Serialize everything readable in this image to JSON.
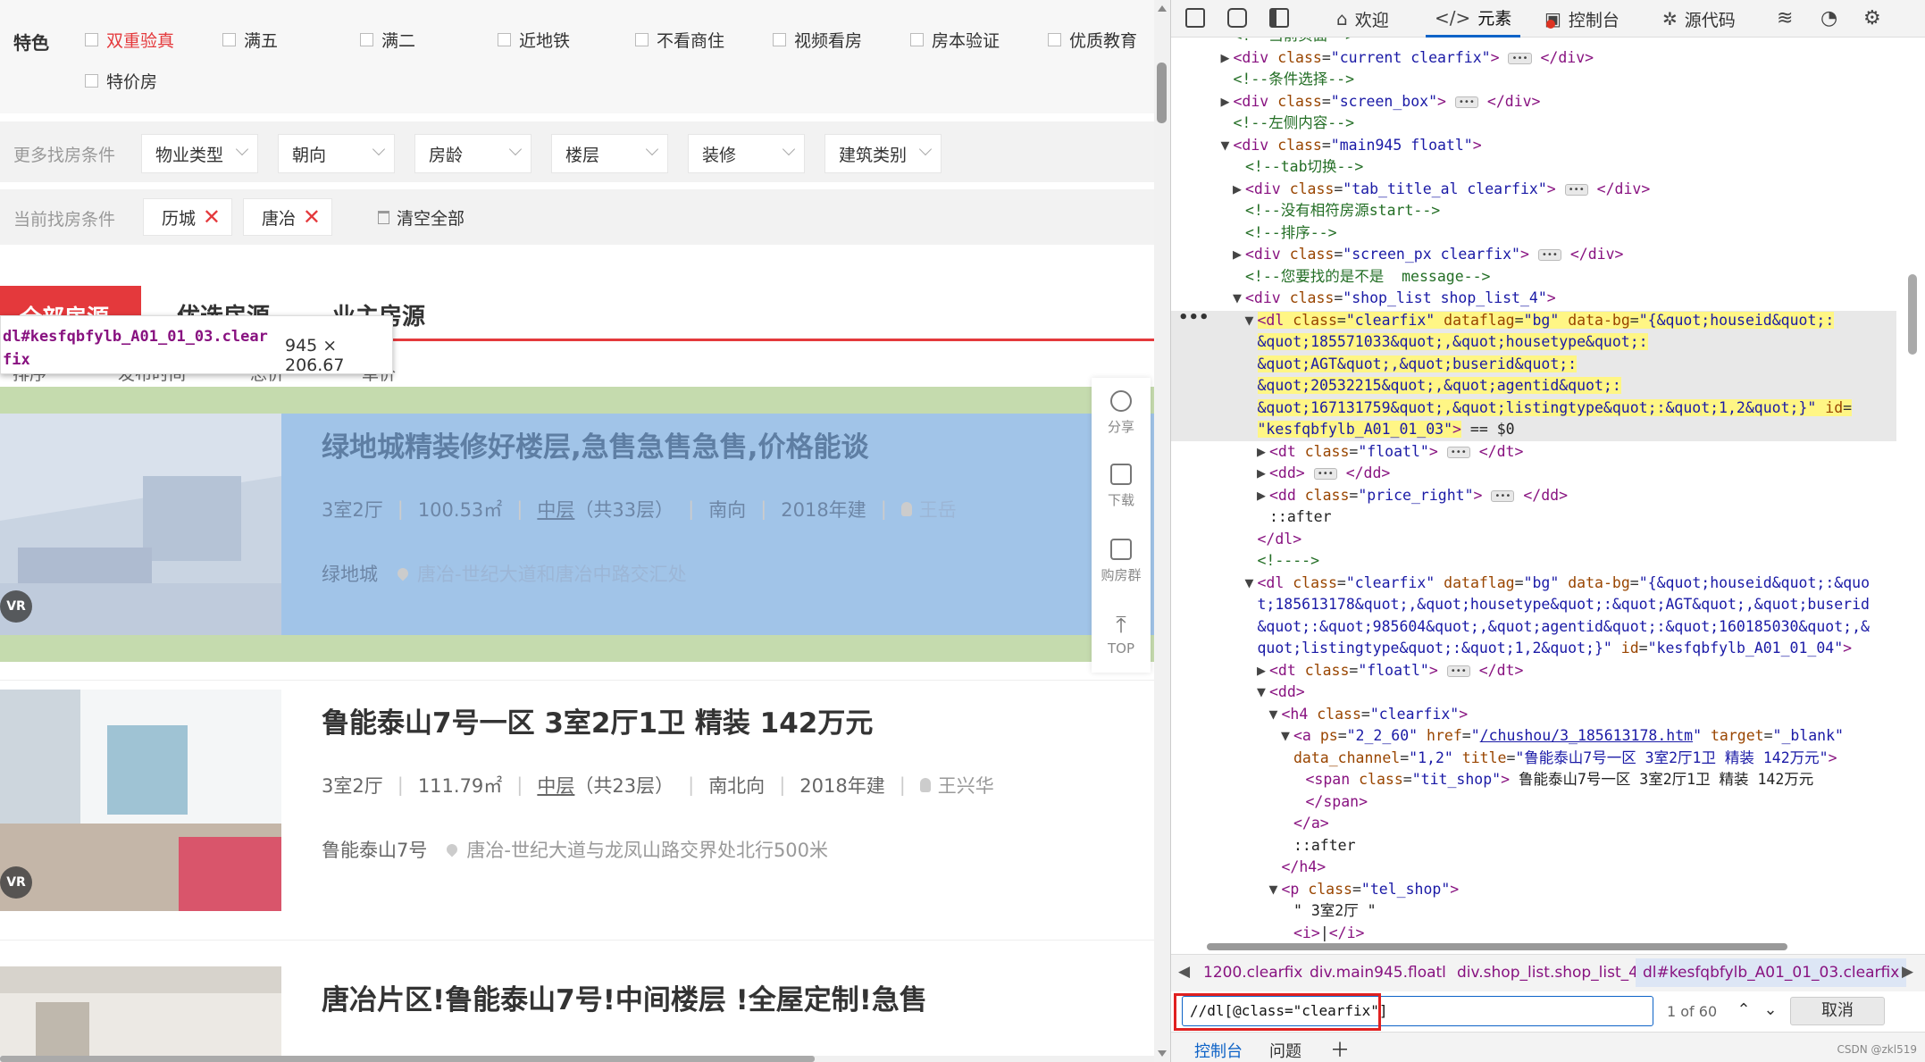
{
  "filters": {
    "feature_label": "特色",
    "features": [
      "双重验真",
      "满五",
      "满二",
      "近地铁",
      "不看商住",
      "视频看房",
      "房本验证",
      "优质教育",
      "特价房"
    ],
    "more_label": "更多找房条件",
    "dropdowns": [
      "物业类型",
      "朝向",
      "房龄",
      "楼层",
      "装修",
      "建筑类别"
    ],
    "current_label": "当前找房条件",
    "current_tags": [
      "历城",
      "唐冶"
    ],
    "clear_all": "清空全部"
  },
  "tabs": [
    "全部房源",
    "优选房源",
    "业主房源"
  ],
  "sort": [
    "排序",
    "发布时间",
    "总价",
    "单价"
  ],
  "tooltip": {
    "selector": "dl#kesfqbfylb_A01_01_03.clearfix",
    "size": "945 × 206.67"
  },
  "listings": [
    {
      "title": "绿地城精装修好楼层,急售急售急售,价格能谈",
      "layout": "3室2厅",
      "area": "100.53㎡",
      "floor": "中层",
      "floor_total": "（共33层）",
      "orientation": "南向",
      "built": "2018年建",
      "agent": "王岳",
      "community": "绿地城",
      "address": "唐冶-世纪大道和唐冶中路交汇处",
      "vr": "VR"
    },
    {
      "title": "鲁能泰山7号一区 3室2厅1卫 精装 142万元",
      "layout": "3室2厅",
      "area": "111.79㎡",
      "floor": "中层",
      "floor_total": "（共23层）",
      "orientation": "南北向",
      "built": "2018年建",
      "agent": "王兴华",
      "community": "鲁能泰山7号",
      "address": "唐冶-世纪大道与龙凤山路交界处北行500米",
      "vr": "VR"
    },
    {
      "title": "唐冶片区!鲁能泰山7号!中间楼层 !全屋定制!急售"
    }
  ],
  "float_bar": [
    "分享",
    "下载",
    "购房群",
    "TOP"
  ],
  "devtools": {
    "tabs": [
      "欢迎",
      "元素",
      "控制台",
      "源代码"
    ],
    "dom_lines": [
      {
        "indent": 5,
        "tri": "",
        "html": "<span class='c'>&lt;!--当前页面--&gt;</span>"
      },
      {
        "indent": 5,
        "tri": "▶",
        "html": "<span class='t'>&lt;div</span> <span class='a'>class</span>=<span class='v'>\"current clearfix\"</span><span class='t'>&gt;</span> <span class='ell'>•••</span> <span class='t'>&lt;/div&gt;</span>"
      },
      {
        "indent": 5,
        "tri": "",
        "html": "<span class='c'>&lt;!--条件选择--&gt;</span>"
      },
      {
        "indent": 5,
        "tri": "▶",
        "html": "<span class='t'>&lt;div</span> <span class='a'>class</span>=<span class='v'>\"screen_box\"</span><span class='t'>&gt;</span> <span class='ell'>•••</span> <span class='t'>&lt;/div&gt;</span>"
      },
      {
        "indent": 5,
        "tri": "",
        "html": "<span class='c'>&lt;!--左侧内容--&gt;</span>"
      },
      {
        "indent": 5,
        "tri": "▼",
        "html": "<span class='t'>&lt;div</span> <span class='a'>class</span>=<span class='v'>\"main945 floatl\"</span><span class='t'>&gt;</span>"
      },
      {
        "indent": 6,
        "tri": "",
        "html": "<span class='c'>&lt;!--tab切换--&gt;</span>"
      },
      {
        "indent": 6,
        "tri": "▶",
        "html": "<span class='t'>&lt;div</span> <span class='a'>class</span>=<span class='v'>\"tab_title_al clearfix\"</span><span class='t'>&gt;</span> <span class='ell'>•••</span> <span class='t'>&lt;/div&gt;</span>"
      },
      {
        "indent": 6,
        "tri": "",
        "html": "<span class='c'>&lt;!--没有相符房源start--&gt;</span>"
      },
      {
        "indent": 6,
        "tri": "",
        "html": "<span class='c'>&lt;!--排序--&gt;</span>"
      },
      {
        "indent": 6,
        "tri": "▶",
        "html": "<span class='t'>&lt;div</span> <span class='a'>class</span>=<span class='v'>\"screen_px clearfix\"</span><span class='t'>&gt;</span> <span class='ell'>•••</span> <span class='t'>&lt;/div&gt;</span>"
      },
      {
        "indent": 6,
        "tri": "",
        "html": "<span class='c'>&lt;!--您要找的是不是  message--&gt;</span>"
      },
      {
        "indent": 6,
        "tri": "▼",
        "html": "<span class='t'>&lt;div</span> <span class='a'>class</span>=<span class='v'>\"shop_list shop_list_4\"</span><span class='t'>&gt;</span>"
      },
      {
        "indent": 7,
        "tri": "▼",
        "html": "<span class='yel'><span class='t'>&lt;dl</span> <span class='a'>class</span>=<span class='v'>\"clearfix\"</span> <span class='a'>dataflag</span>=<span class='v'>\"bg\"</span> <span class='a'>data-bg</span>=<span class='v'>\"{&amp;quot;houseid&amp;quot;:</span></span>"
      },
      {
        "indent": 7,
        "tri": "",
        "html": "<span class='yel'><span class='v'>&amp;quot;185571033&amp;quot;,&amp;quot;housetype&amp;quot;:</span></span>"
      },
      {
        "indent": 7,
        "tri": "",
        "html": "<span class='yel'><span class='v'>&amp;quot;AGT&amp;quot;,&amp;quot;buserid&amp;quot;:</span></span>"
      },
      {
        "indent": 7,
        "tri": "",
        "html": "<span class='yel'><span class='v'>&amp;quot;20532215&amp;quot;,&amp;quot;agentid&amp;quot;:</span></span>"
      },
      {
        "indent": 7,
        "tri": "",
        "html": "<span class='yel'><span class='v'>&amp;quot;167131759&amp;quot;,&amp;quot;listingtype&amp;quot;:&amp;quot;1,2&amp;quot;}\"</span> <span class='a'>id</span>=</span>"
      },
      {
        "indent": 7,
        "tri": "",
        "html": "<span class='yel'><span class='v'>\"kesfqbfylb_A01_01_03\"</span><span class='t'>&gt;</span></span> <span class='tx'>== $0</span>"
      },
      {
        "indent": 8,
        "tri": "▶",
        "html": "<span class='t'>&lt;dt</span> <span class='a'>class</span>=<span class='v'>\"floatl\"</span><span class='t'>&gt;</span> <span class='ell'>•••</span> <span class='t'>&lt;/dt&gt;</span>"
      },
      {
        "indent": 8,
        "tri": "▶",
        "html": "<span class='t'>&lt;dd&gt;</span> <span class='ell'>•••</span> <span class='t'>&lt;/dd&gt;</span>"
      },
      {
        "indent": 8,
        "tri": "▶",
        "html": "<span class='t'>&lt;dd</span> <span class='a'>class</span>=<span class='v'>\"price_right\"</span><span class='t'>&gt;</span> <span class='ell'>•••</span> <span class='t'>&lt;/dd&gt;</span>"
      },
      {
        "indent": 8,
        "tri": "",
        "html": "<span class='tx'>::after</span>"
      },
      {
        "indent": 7,
        "tri": "",
        "html": "<span class='t'>&lt;/dl&gt;</span>"
      },
      {
        "indent": 7,
        "tri": "",
        "html": "<span class='c'>&lt;!----&gt;</span>"
      },
      {
        "indent": 7,
        "tri": "▼",
        "html": "<span class='t'>&lt;dl</span> <span class='a'>class</span>=<span class='v'>\"clearfix\"</span> <span class='a'>dataflag</span>=<span class='v'>\"bg\"</span> <span class='a'>data-bg</span>=<span class='v'>\"{&amp;quot;houseid&amp;quot;:&amp;quo</span>"
      },
      {
        "indent": 7,
        "tri": "",
        "html": "<span class='v'>t;185613178&amp;quot;,&amp;quot;housetype&amp;quot;:&amp;quot;AGT&amp;quot;,&amp;quot;buserid</span>"
      },
      {
        "indent": 7,
        "tri": "",
        "html": "<span class='v'>&amp;quot;:&amp;quot;985604&amp;quot;,&amp;quot;agentid&amp;quot;:&amp;quot;160185030&amp;quot;,&amp;</span>"
      },
      {
        "indent": 7,
        "tri": "",
        "html": "<span class='v'>quot;listingtype&amp;quot;:&amp;quot;1,2&amp;quot;}\"</span> <span class='a'>id</span>=<span class='v'>\"kesfqbfylb_A01_01_04\"</span><span class='t'>&gt;</span>"
      },
      {
        "indent": 8,
        "tri": "▶",
        "html": "<span class='t'>&lt;dt</span> <span class='a'>class</span>=<span class='v'>\"floatl\"</span><span class='t'>&gt;</span> <span class='ell'>•••</span> <span class='t'>&lt;/dt&gt;</span>"
      },
      {
        "indent": 8,
        "tri": "▼",
        "html": "<span class='t'>&lt;dd&gt;</span>"
      },
      {
        "indent": 9,
        "tri": "▼",
        "html": "<span class='t'>&lt;h4</span> <span class='a'>class</span>=<span class='v'>\"clearfix\"</span><span class='t'>&gt;</span>"
      },
      {
        "indent": 10,
        "tri": "▼",
        "html": "<span class='t'>&lt;a</span> <span class='a'>ps</span>=<span class='v'>\"2_2_60\"</span> <span class='a'>href</span>=<span class='v'>\"<u>/chushou/3_185613178.htm</u>\"</span> <span class='a'>target</span>=<span class='v'>\"_blank\"</span>"
      },
      {
        "indent": 10,
        "tri": "",
        "html": "<span class='a'>data_channel</span>=<span class='v'>\"1,2\"</span> <span class='a'>title</span>=<span class='v'>\"鲁能泰山7号一区 3室2厅1卫 精装 142万元\"</span><span class='t'>&gt;</span>"
      },
      {
        "indent": 11,
        "tri": "",
        "html": "<span class='t'>&lt;span</span> <span class='a'>class</span>=<span class='v'>\"tit_shop\"</span><span class='t'>&gt;</span> <span class='tx'>鲁能泰山7号一区 3室2厅1卫 精装 142万元</span>"
      },
      {
        "indent": 11,
        "tri": "",
        "html": "<span class='t'>&lt;/span&gt;</span>"
      },
      {
        "indent": 10,
        "tri": "",
        "html": "<span class='t'>&lt;/a&gt;</span>"
      },
      {
        "indent": 10,
        "tri": "",
        "html": "<span class='tx'>::after</span>"
      },
      {
        "indent": 9,
        "tri": "",
        "html": "<span class='t'>&lt;/h4&gt;</span>"
      },
      {
        "indent": 9,
        "tri": "▼",
        "html": "<span class='t'>&lt;p</span> <span class='a'>class</span>=<span class='v'>\"tel_shop\"</span><span class='t'>&gt;</span>"
      },
      {
        "indent": 10,
        "tri": "",
        "html": "<span class='tx'>\" 3室2厅 \"</span>"
      },
      {
        "indent": 10,
        "tri": "",
        "html": "<span class='t'>&lt;i&gt;</span><span class='tx'>|</span><span class='t'>&lt;/i&gt;</span>"
      }
    ],
    "breadcrumbs": [
      "1200.clearfix",
      "div.main945.floatl",
      "div.shop_list.shop_list_4",
      "dl#kesfqbfylb_A01_01_03.clearfix"
    ],
    "search_value": "//dl[@class=\"clearfix\"]",
    "match_count": "1 of 60",
    "cancel": "取消",
    "drawer_tabs": [
      "控制台",
      "问题"
    ],
    "watermark": "CSDN @zkl519"
  }
}
